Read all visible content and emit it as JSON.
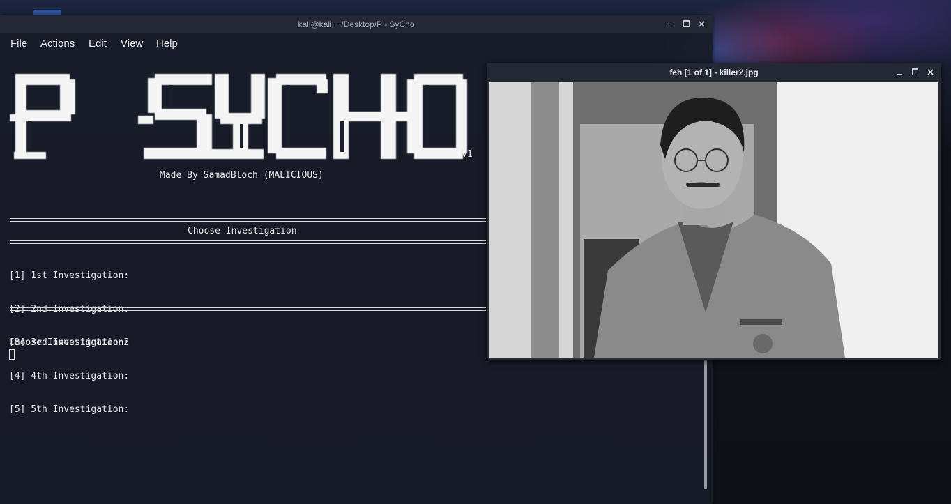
{
  "terminal": {
    "title": "kali@kali: ~/Desktop/P - SyCho",
    "menu": [
      "File",
      "Actions",
      "Edit",
      "View",
      "Help"
    ],
    "banner_text": "P SYCHO",
    "banner_version": "V1",
    "made_by": "Made By SamadBloch (MALICIOUS)",
    "menu_heading": "Choose Investigation",
    "options": [
      "[1] 1st Investigation:",
      "[2] 2nd Investigation:",
      "[3] 3rd Investigation:",
      "[4] 4th Investigation:",
      "[5] 5th Investigation:"
    ],
    "prompt": "Choose Investigation:2"
  },
  "image_viewer": {
    "title": "feh [1 of 1] - killer2.jpg",
    "image_subject": "black-and-white photo of a man with glasses and mustache wearing a prison uniform"
  },
  "colors": {
    "terminal_bg": "#181c28",
    "titlebar_bg": "#242734",
    "text": "#e6e6e6"
  }
}
